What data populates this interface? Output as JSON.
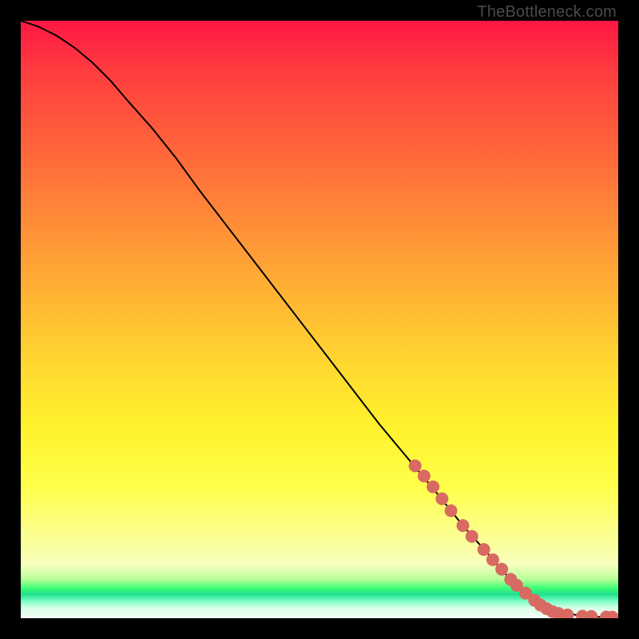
{
  "watermark": "TheBottleneck.com",
  "colors": {
    "curve_stroke": "#000000",
    "dot_fill": "#d96a62",
    "dot_stroke": "#d96a62"
  },
  "chart_data": {
    "type": "line",
    "title": "",
    "xlabel": "",
    "ylabel": "",
    "xlim": [
      0,
      100
    ],
    "ylim": [
      0,
      100
    ],
    "grid": false,
    "legend": false,
    "series": [
      {
        "name": "curve",
        "x": [
          0,
          3,
          6,
          9,
          12,
          15,
          18,
          22,
          26,
          30,
          35,
          40,
          45,
          50,
          55,
          60,
          65,
          70,
          74,
          78,
          81,
          84,
          86,
          88,
          90,
          92,
          94,
          96,
          98,
          100
        ],
        "y": [
          100,
          99,
          97.5,
          95.5,
          93,
          90,
          86.5,
          82,
          77,
          71.5,
          65,
          58.5,
          52,
          45.5,
          39,
          32.5,
          26.5,
          20.5,
          15.5,
          11,
          7.5,
          5,
          3.2,
          2.0,
          1.2,
          0.7,
          0.4,
          0.25,
          0.15,
          0.1
        ]
      }
    ],
    "dots": {
      "name": "highlighted-points",
      "points": [
        {
          "x": 66.0,
          "y": 25.5
        },
        {
          "x": 67.5,
          "y": 23.8
        },
        {
          "x": 69.0,
          "y": 22.0
        },
        {
          "x": 70.5,
          "y": 20.0
        },
        {
          "x": 72.0,
          "y": 18.0
        },
        {
          "x": 74.0,
          "y": 15.5
        },
        {
          "x": 75.5,
          "y": 13.7
        },
        {
          "x": 77.5,
          "y": 11.5
        },
        {
          "x": 79.0,
          "y": 9.8
        },
        {
          "x": 80.5,
          "y": 8.2
        },
        {
          "x": 82.0,
          "y": 6.5
        },
        {
          "x": 83.0,
          "y": 5.5
        },
        {
          "x": 84.5,
          "y": 4.2
        },
        {
          "x": 86.0,
          "y": 3.0
        },
        {
          "x": 87.0,
          "y": 2.2
        },
        {
          "x": 88.0,
          "y": 1.6
        },
        {
          "x": 89.0,
          "y": 1.1
        },
        {
          "x": 90.0,
          "y": 0.8
        },
        {
          "x": 91.5,
          "y": 0.55
        },
        {
          "x": 94.0,
          "y": 0.35
        },
        {
          "x": 95.5,
          "y": 0.3
        },
        {
          "x": 98.0,
          "y": 0.2
        },
        {
          "x": 99.0,
          "y": 0.18
        }
      ],
      "radius": 7.5
    }
  }
}
